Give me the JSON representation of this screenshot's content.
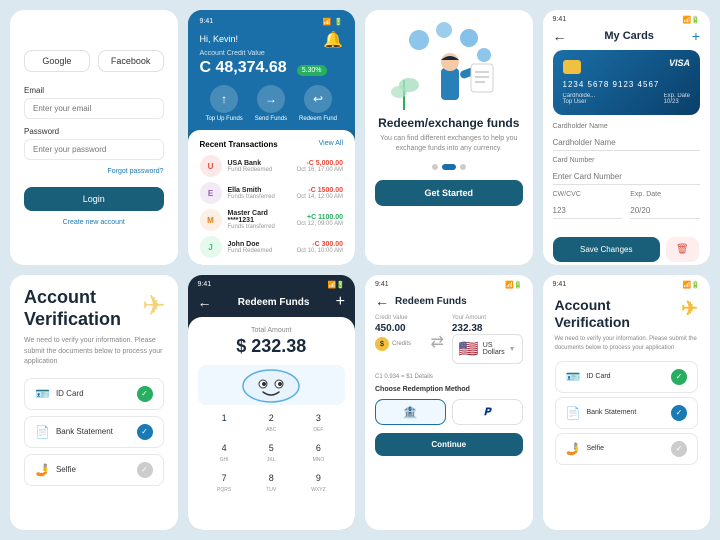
{
  "login": {
    "google_label": "Google",
    "facebook_label": "Facebook",
    "email_label": "Email",
    "email_placeholder": "Enter your email",
    "password_label": "Password",
    "password_placeholder": "Enter your password",
    "forgot_label": "Forgot password?",
    "login_btn": "Login",
    "create_label": "Create new account"
  },
  "dashboard": {
    "time": "9:41",
    "greeting": "Hi, Kevin!",
    "credit_label": "Account Credit Value",
    "amount": "C 48,374.68",
    "badge": "5.30%",
    "actions": [
      "Top Up Funds",
      "Send Funds",
      "Redeem Fund"
    ],
    "action_icons": [
      "↑",
      "→",
      "↩"
    ],
    "recent_title": "Recent Transactions",
    "view_all": "View All",
    "transactions": [
      {
        "name": "USA Bank",
        "type": "Fund Redeemed",
        "amount": "-C 5,000.00",
        "date": "Oct 16, 17:00 AM",
        "neg": true,
        "initials": "U",
        "color": "#e74c3c"
      },
      {
        "name": "Ella Smith",
        "type": "Funds transferred",
        "amount": "-C 1500.00",
        "date": "Oct 14, 12:00 AM",
        "neg": true,
        "initials": "E",
        "color": "#9b59b6"
      },
      {
        "name": "Master Card ****1231",
        "type": "Funds transferred",
        "amount": "+C 1100.00",
        "date": "Oct 12, 09:00 AM",
        "neg": false,
        "initials": "M",
        "color": "#e67e22"
      },
      {
        "name": "John Doe",
        "type": "Fund Redeemed",
        "amount": "-C 300.00",
        "date": "Oct 10, 10:00 AM",
        "neg": true,
        "initials": "J",
        "color": "#2ecc71"
      }
    ]
  },
  "hero": {
    "title": "Redeem/exchange funds",
    "description": "You can find different exchanges to help you exchange funds into any currency.",
    "btn_label": "Get Started"
  },
  "mycards": {
    "time": "9:41",
    "title": "My Cards",
    "card_number": "1234 5678 9123 4567",
    "card_holder": "Cardholde...",
    "card_expiry": "10/23",
    "card_name": "Top User",
    "visa": "VISA",
    "cardholder_label": "Cardholder Name",
    "cardholder_placeholder": "Cardholder Name",
    "card_number_label": "Card Number",
    "card_number_placeholder": "Enter Card Number",
    "cvv_label": "CW/CVC",
    "cvv_placeholder": "123",
    "exp_label": "Exp. Date",
    "exp_placeholder": "20/20",
    "save_btn": "Save Changes"
  },
  "verify1": {
    "title": "Account Verification",
    "description": "We need to verify your information. Please submit the documents below to process your application",
    "items": [
      {
        "icon": "🪪",
        "label": "ID Card",
        "status": "green"
      },
      {
        "icon": "📄",
        "label": "Bank Statement",
        "status": "blue"
      },
      {
        "icon": "🤳",
        "label": "Selfie",
        "status": "gray"
      }
    ]
  },
  "redeem_small": {
    "time": "9:41",
    "title": "Redeem Funds",
    "total_label": "Total Amount",
    "amount": "$ 232.38",
    "numpad": [
      {
        "main": "1",
        "sub": ""
      },
      {
        "main": "2",
        "sub": "ABC"
      },
      {
        "main": "3",
        "sub": "DEF"
      },
      {
        "main": "4",
        "sub": "GHI"
      },
      {
        "main": "5",
        "sub": "JKL"
      },
      {
        "main": "6",
        "sub": "MNO"
      },
      {
        "main": "7",
        "sub": "PQRS"
      },
      {
        "main": "8",
        "sub": "TUV"
      },
      {
        "main": "9",
        "sub": "WXYZ"
      }
    ]
  },
  "redeem_full": {
    "time": "9:41",
    "title": "Redeem Funds",
    "credit_label": "Credit Value",
    "credit_value": "450.00",
    "amount_label": "Your Amount",
    "amount_value": "232.38",
    "credits_tag": "Credits",
    "currency_flag": "🇺🇸",
    "currency_label": "US Dollars",
    "conversion": "C1 0.934 = $1  Details",
    "method_title": "Choose Redemption Method",
    "methods": [
      "💳",
      "𝐏"
    ],
    "continue_btn": "Continue"
  },
  "verify2": {
    "time": "9:41",
    "title": "Account\nVerification",
    "description": "We need to verify your information. Please submit the documents below to process your application"
  }
}
